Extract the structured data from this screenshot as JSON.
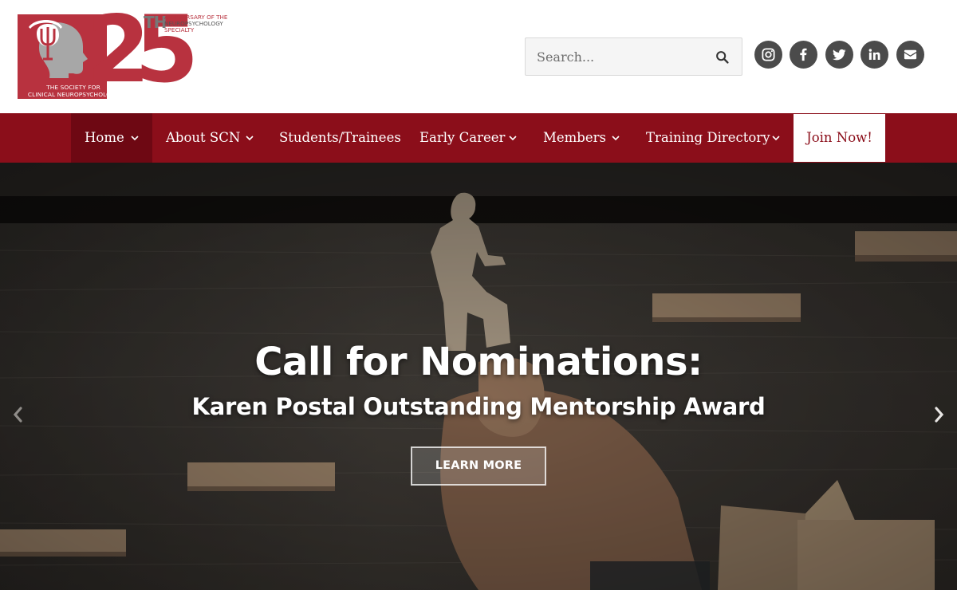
{
  "logo": {
    "digits": "25",
    "superscript": "TH",
    "anniversary_line1": "ANNIVERSARY OF THE",
    "anniversary_line2": "NEUROPSYCHOLOGY",
    "anniversary_line3": "SPECIALTY",
    "caption_line1": "THE SOCIETY FOR",
    "caption_line2": "CLINICAL NEUROPSYCHOLOGY",
    "icon": "psi-head-icon"
  },
  "search": {
    "placeholder": "Search...",
    "icon": "search-icon"
  },
  "social": [
    {
      "name": "instagram",
      "icon": "instagram-icon"
    },
    {
      "name": "facebook",
      "icon": "facebook-icon"
    },
    {
      "name": "twitter",
      "icon": "twitter-icon"
    },
    {
      "name": "linkedin",
      "icon": "linkedin-icon"
    },
    {
      "name": "email",
      "icon": "envelope-icon"
    }
  ],
  "nav": {
    "items": [
      {
        "label": "Home",
        "has_dropdown": true,
        "active": true
      },
      {
        "label": "About SCN",
        "has_dropdown": true
      },
      {
        "label": "Students/Trainees",
        "has_dropdown": false
      },
      {
        "label": "Early Career",
        "has_dropdown": true
      },
      {
        "label": "Members",
        "has_dropdown": true
      },
      {
        "label": "Training Directory",
        "has_dropdown": true
      }
    ],
    "cta_label": "Join Now!"
  },
  "hero": {
    "title": "Call for Nominations:",
    "subtitle": "Karen Postal Outstanding Mentorship Award",
    "button_label": "LEARN MORE",
    "prev_icon": "chevron-left-icon",
    "next_icon": "chevron-right-icon"
  },
  "colors": {
    "brand_red": "#b8323f",
    "nav_red": "#8b0e1a",
    "nav_active": "#6e0813",
    "social_bg": "#4b4b4b"
  }
}
